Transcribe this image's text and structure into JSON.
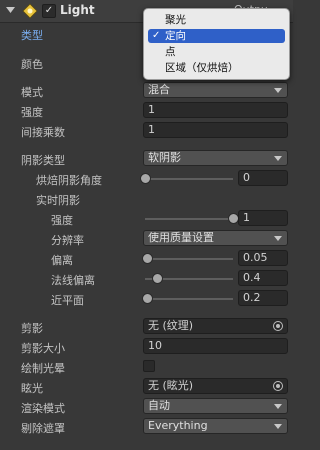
{
  "header": {
    "title": "Light",
    "enabled_check": "✓",
    "right_text": "Outpu"
  },
  "props": {
    "type_label": "类型",
    "color_label": "颜色",
    "mode_label": "模式",
    "mode_value": "混合",
    "intensity_label": "强度",
    "intensity_value": "1",
    "indirect_label": "间接乘数",
    "indirect_value": "1",
    "shadow_type_label": "阴影类型",
    "shadow_type_value": "软阴影",
    "baked_angle_label": "烘焙阴影角度",
    "baked_angle_value": "0",
    "realtime_label": "实时阴影",
    "strength_label": "强度",
    "strength_value": "1",
    "resolution_label": "分辨率",
    "resolution_value": "使用质量设置",
    "bias_label": "偏离",
    "bias_value": "0.05",
    "normal_bias_label": "法线偏离",
    "normal_bias_value": "0.4",
    "near_plane_label": "近平面",
    "near_plane_value": "0.2",
    "cookie_label": "剪影",
    "cookie_value": "无 (纹理)",
    "cookie_size_label": "剪影大小",
    "cookie_size_value": "10",
    "draw_halo_label": "绘制光晕",
    "flare_label": "眩光",
    "flare_value": "无 (眩光)",
    "render_mode_label": "渲染模式",
    "render_mode_value": "自动",
    "culling_label": "剔除遮罩",
    "culling_value": "Everything"
  },
  "sliders": {
    "baked_angle": 0,
    "strength": 1,
    "bias": 0.05,
    "normal_bias": 0.4,
    "near_plane": 0.2
  },
  "type_menu": {
    "items": [
      "聚光",
      "定向",
      "点",
      "区域（仅烘焙）"
    ],
    "selected": "定向",
    "check": "✓"
  },
  "colors": {
    "accent_blue": "#7aaef0",
    "menu_selection": "#2f60c8",
    "light_color": "#e7e7e7"
  }
}
